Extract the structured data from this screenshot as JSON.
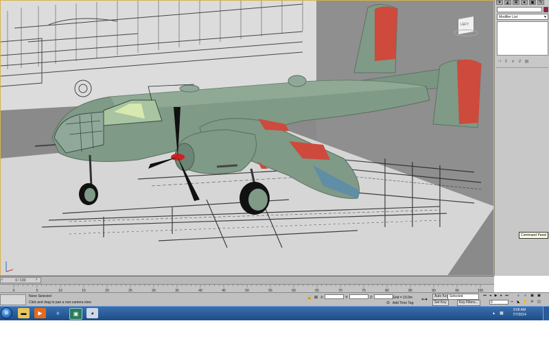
{
  "timeline": {
    "frame_indicator": "0 / 100",
    "ticks": [
      "0",
      "5",
      "10",
      "15",
      "20",
      "25",
      "30",
      "35",
      "40",
      "45",
      "50",
      "55",
      "60",
      "65",
      "70",
      "75",
      "80",
      "85",
      "90",
      "95",
      "100"
    ]
  },
  "command_panel": {
    "modifier_list_label": "Modifier List",
    "tooltip": "Command Panel"
  },
  "status": {
    "selection": "None Selected",
    "prompt": "Click and drag to pan a non-camera view",
    "x_label": "X:",
    "y_label": "Y:",
    "z_label": "Z:",
    "grid": "Grid = 10.0m",
    "add_time_tag": "Add Time Tag",
    "auto_key": "Auto Key",
    "set_key": "Set Key",
    "key_mode_value": "Selected",
    "key_filters": "Key Filters...",
    "current_frame": "0"
  },
  "viewcube": {
    "face_label": "LEFT"
  },
  "taskbar": {
    "time": "9:06 AM",
    "date": "7/7/2014"
  },
  "colors": {
    "aircraft_body": "#7f9a86",
    "insignia_red": "#cd4a3c",
    "wing_blue": "#5f8ea6",
    "viewport_bg": "#8a8a8a",
    "taskbar_blue": "#1f4c86"
  },
  "icons": [
    "start-orb-icon",
    "explorer-folder-icon",
    "media-player-icon",
    "internet-explorer-icon",
    "3dsmax-icon",
    "paint-icon"
  ]
}
